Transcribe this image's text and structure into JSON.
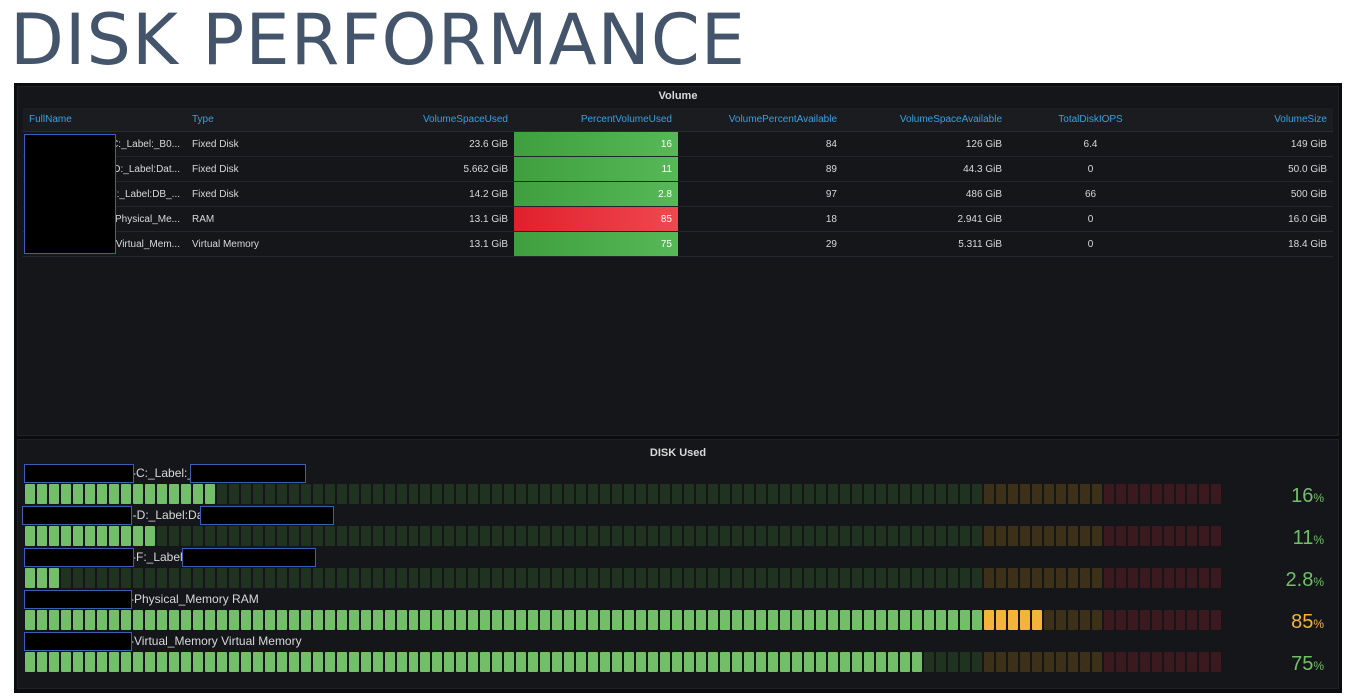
{
  "page": {
    "title": "DISK PERFORMANCE"
  },
  "volume_panel": {
    "title": "Volume",
    "columns": [
      "FullName",
      "Type",
      "VolumeSpaceUsed",
      "PercentVolumeUsed",
      "VolumePercentAvailable",
      "VolumeSpaceAvailable",
      "TotalDiskIOPS",
      "VolumeSize"
    ],
    "rows": [
      {
        "fullname": "C:_Label:_B0...",
        "type": "Fixed Disk",
        "used": "23.6 GiB",
        "pct_used": "16",
        "pct_avail": "84",
        "avail": "126 GiB",
        "iops": "6.4",
        "size": "149 GiB",
        "status": "ok"
      },
      {
        "fullname": "D:_Label:Dat...",
        "type": "Fixed Disk",
        "used": "5.662 GiB",
        "pct_used": "11",
        "pct_avail": "89",
        "avail": "44.3 GiB",
        "iops": "0",
        "size": "50.0 GiB",
        "status": "ok"
      },
      {
        "fullname": "F:_Label:DB_...",
        "type": "Fixed Disk",
        "used": "14.2 GiB",
        "pct_used": "2.8",
        "pct_avail": "97",
        "avail": "486 GiB",
        "iops": "66",
        "size": "500 GiB",
        "status": "ok"
      },
      {
        "fullname": "Physical_Me...",
        "type": "RAM",
        "used": "13.1 GiB",
        "pct_used": "85",
        "pct_avail": "18",
        "avail": "2.941 GiB",
        "iops": "0",
        "size": "16.0 GiB",
        "status": "critical"
      },
      {
        "fullname": "Virtual_Mem...",
        "type": "Virtual Memory",
        "used": "13.1 GiB",
        "pct_used": "75",
        "pct_avail": "29",
        "avail": "5.311 GiB",
        "iops": "0",
        "size": "18.4 GiB",
        "status": "ok"
      }
    ]
  },
  "disk_panel": {
    "title": "DISK Used",
    "unit": "%",
    "items": [
      {
        "label": "-C:_Label:_",
        "value_text": "16",
        "value": 16,
        "value_color": "#73bf69"
      },
      {
        "label": "1-D:_Label:Dat",
        "value_text": "11",
        "value": 11,
        "value_color": "#73bf69"
      },
      {
        "label": "-F:_Label:",
        "value_text": "2.8",
        "value": 2.8,
        "value_color": "#73bf69"
      },
      {
        "label": "-Physical_Memory RAM",
        "value_text": "85",
        "value": 85,
        "value_color": "#f2b53a"
      },
      {
        "label": "-Virtual_Memory Virtual Memory",
        "value_text": "75",
        "value": 75,
        "value_color": "#73bf69"
      }
    ],
    "thresholds": {
      "warn": 80,
      "crit": 90
    },
    "colors": {
      "green_on": "#73bf69",
      "green_off": "#1f3320",
      "yellow_on": "#f2b53a",
      "yellow_off": "#3c3018",
      "red_on": "#e02f44",
      "red_off": "#3a1a1f"
    }
  }
}
